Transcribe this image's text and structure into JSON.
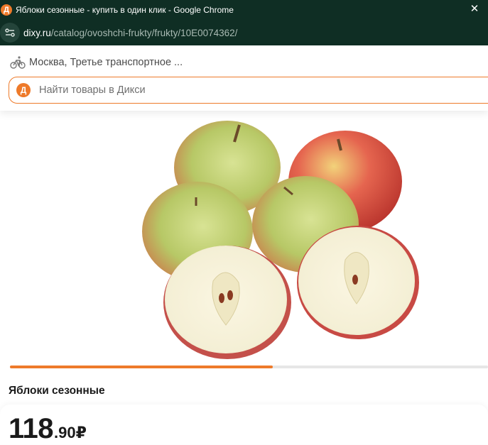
{
  "browser": {
    "tab_title": "Яблоки сезонные - купить в один клик - Google Chrome",
    "favicon_letter": "Д",
    "url_host": "dixy.ru",
    "url_path": "/catalog/ovoshchi-frukty/frukty/10E0074362/",
    "close_symbol": "✕"
  },
  "header": {
    "location": "Москва, Третье транспортное ...",
    "search_placeholder": "Найти товары в Дикси",
    "logo_letter": "Д"
  },
  "gallery": {
    "progress": 0.55,
    "image_alt": "apples-photo"
  },
  "product": {
    "name": "Яблоки сезонные",
    "price_rub": "118",
    "price_kop": ".90",
    "currency": "₽"
  },
  "colors": {
    "brand": "#ee7a2a",
    "browser_bg": "#0f2e24"
  }
}
